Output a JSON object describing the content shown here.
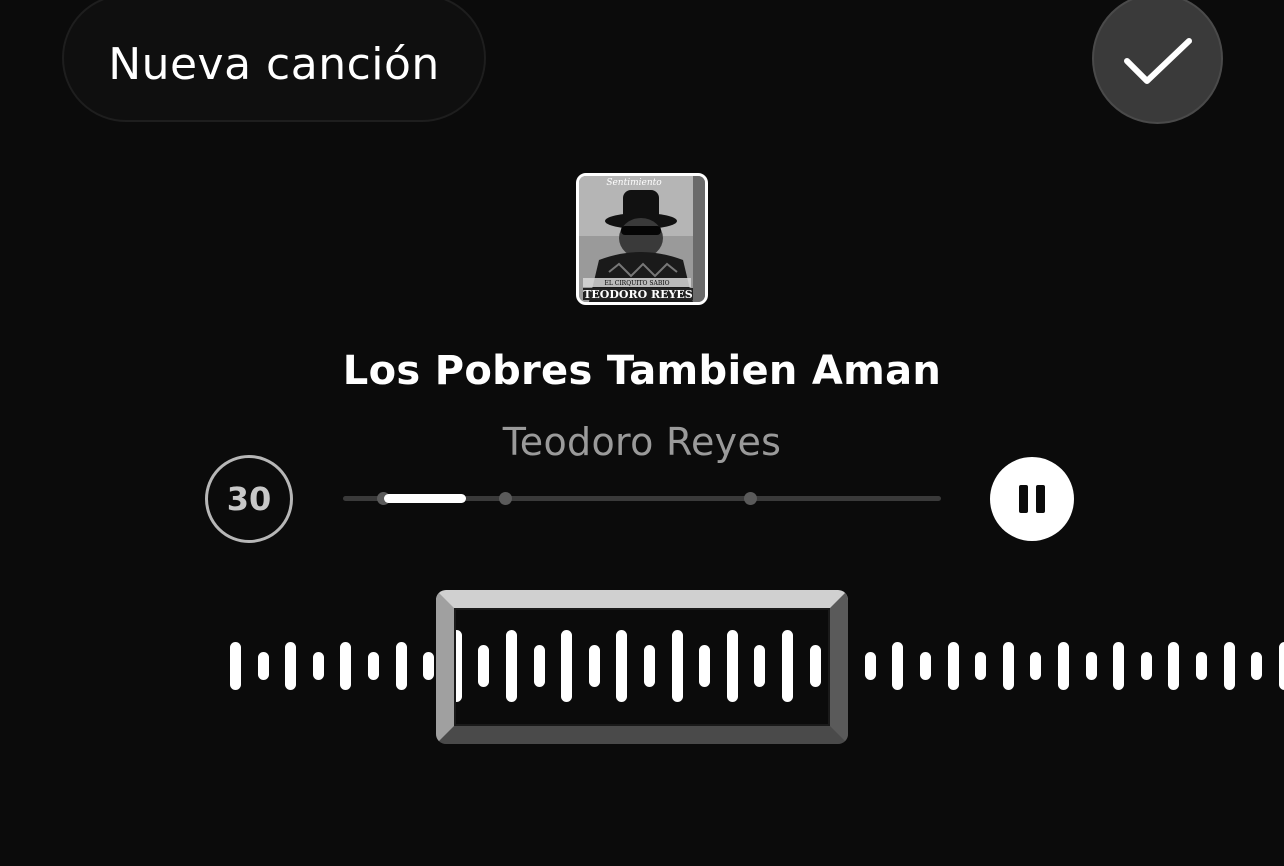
{
  "header": {
    "new_song_label": "Nueva canción",
    "done_icon": "checkmark-icon"
  },
  "track": {
    "album_art_icon": "album-art",
    "album_art_text_top": "Sentimiento",
    "album_art_text_sub": "EL CIRQUITO SABIO",
    "album_art_text_bottom": "TEODORO REYES",
    "title": "Los Pobres Tambien Aman",
    "artist": "Teodoro Reyes"
  },
  "player": {
    "duration_badge": "30",
    "progress_fraction": 0.14,
    "pause_icon": "pause-icon"
  },
  "colors": {
    "background": "#0b0b0b",
    "text_primary": "#ffffff",
    "text_secondary": "#9a9a9a",
    "done_button": "#3a3a3a"
  }
}
